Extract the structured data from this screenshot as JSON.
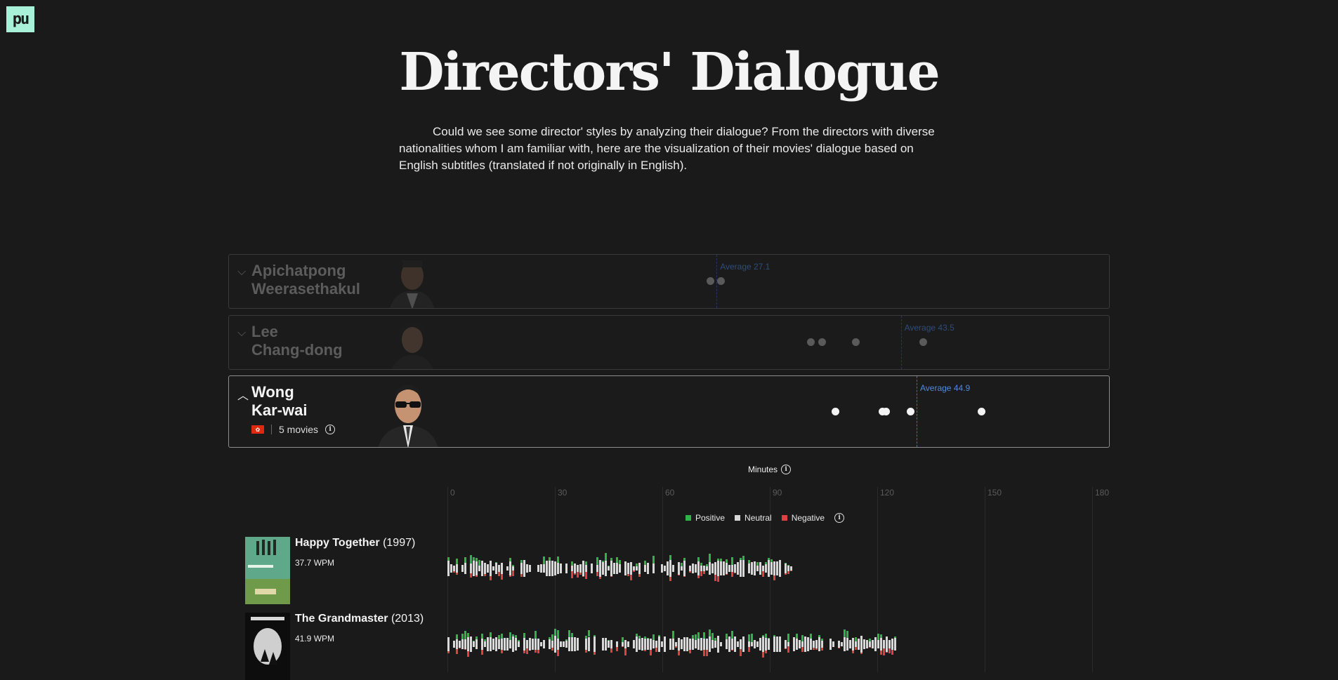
{
  "logo_text": "pu",
  "title": "Directors' Dialogue",
  "intro": "Could we see some director' styles by analyzing their dialogue? From the directors with diverse nationalities whom I am familiar with, here are the visualization of their movies' dialogue based on English subtitles (translated if not originally in English).",
  "directors": [
    {
      "first": "Apichatpong",
      "last": "Weerasethakul",
      "expanded": false,
      "average_label": "Average 27.1",
      "average_wpm": 27.1,
      "movie_wpm": [
        26.6,
        27.5
      ]
    },
    {
      "first": "Lee",
      "last": "Chang-dong",
      "expanded": false,
      "average_label": "Average 43.5",
      "average_wpm": 43.5,
      "movie_wpm": [
        35.5,
        36.5,
        39.5,
        45.5
      ]
    },
    {
      "first": "Wong",
      "last": "Kar-wai",
      "expanded": true,
      "average_label": "Average 44.9",
      "average_wpm": 44.9,
      "movie_wpm": [
        37.7,
        41.9,
        42.2,
        44.4,
        50.7
      ],
      "flag_icon": "hong-kong-flag-icon",
      "movies_count_label": "5 movies"
    }
  ],
  "timeline": {
    "axis_title": "Minutes",
    "ticks": [
      "0",
      "30",
      "60",
      "90",
      "120",
      "150",
      "180"
    ],
    "legend": [
      {
        "label": "Positive",
        "color": "#2fb34a"
      },
      {
        "label": "Neutral",
        "color": "#d8d8d8"
      },
      {
        "label": "Negative",
        "color": "#e04040"
      }
    ]
  },
  "movies": [
    {
      "title": "Happy Together",
      "year": "(1997)",
      "wpm_label": "37.7 WPM",
      "duration_min": 96,
      "poster_color": "#5fa98a"
    },
    {
      "title": "The Grandmaster",
      "year": "(2013)",
      "wpm_label": "41.9 WPM",
      "duration_min": 126,
      "poster_color": "#0d0d0d"
    }
  ],
  "colors": {
    "accent_blue": "#4f8ae0",
    "background": "#1a1a1a"
  }
}
